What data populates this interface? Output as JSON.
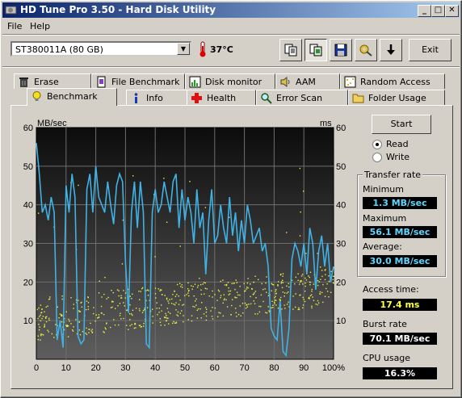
{
  "window": {
    "title": "HD Tune Pro 3.50 - Hard Disk Utility",
    "controls": {
      "minimize": "_",
      "maximize": "□",
      "close": "✕"
    }
  },
  "menu": {
    "file": "File",
    "help": "Help"
  },
  "toolbar": {
    "drive": "ST380011A (80 GB)",
    "temperature": "37°C",
    "buttons": [
      "copy-info-icon",
      "copy-screenshot-icon",
      "save-icon",
      "options-icon",
      "download-icon"
    ],
    "exit_label": "Exit"
  },
  "tabs_top": [
    {
      "label": "Erase",
      "icon": "trash-icon"
    },
    {
      "label": "File Benchmark",
      "icon": "file-benchmark-icon"
    },
    {
      "label": "Disk monitor",
      "icon": "disk-monitor-icon"
    },
    {
      "label": "AAM",
      "icon": "speaker-icon"
    },
    {
      "label": "Random Access",
      "icon": "random-access-icon"
    }
  ],
  "tabs_bottom": [
    {
      "label": "Benchmark",
      "icon": "lightbulb-icon",
      "active": true
    },
    {
      "label": "Info",
      "icon": "info-icon"
    },
    {
      "label": "Health",
      "icon": "health-cross-icon"
    },
    {
      "label": "Error Scan",
      "icon": "magnifier-icon"
    },
    {
      "label": "Folder Usage",
      "icon": "folder-icon"
    }
  ],
  "controls": {
    "start_label": "Start",
    "read_label": "Read",
    "write_label": "Write",
    "mode": "Read"
  },
  "results": {
    "group_title": "Transfer rate",
    "minimum_label": "Minimum",
    "minimum": "1.3 MB/sec",
    "maximum_label": "Maximum",
    "maximum": "56.1 MB/sec",
    "average_label": "Average:",
    "average": "30.0 MB/sec",
    "access_label": "Access time:",
    "access": "17.4 ms",
    "burst_label": "Burst rate",
    "burst": "70.1 MB/sec",
    "cpu_label": "CPU usage",
    "cpu": "16.3%"
  },
  "colors": {
    "transfer_line": "#3fb2e6",
    "access_points": "#f0f040",
    "chart_bg_top": "#111111",
    "chart_bg_bottom": "#5a5a5a",
    "value_text": "#5fd6ff"
  },
  "chart_data": {
    "type": "line",
    "ylabel_left": "MB/sec",
    "ylabel_right": "ms",
    "ylim": [
      0,
      60
    ],
    "xlim": [
      0,
      100
    ],
    "y_ticks": [
      "0",
      "10",
      "20",
      "30",
      "40",
      "50",
      "60"
    ],
    "x_ticks": [
      "0",
      "10",
      "20",
      "30",
      "40",
      "50",
      "60",
      "70",
      "80",
      "90",
      "100%"
    ],
    "grid": true,
    "series": [
      {
        "values_x": [
          0,
          1,
          2,
          3,
          4,
          5,
          6,
          7,
          8,
          9,
          10,
          11,
          12,
          13,
          14,
          15,
          16,
          17,
          18,
          19,
          20,
          21,
          22,
          23,
          24,
          25,
          26,
          27,
          28,
          29,
          30,
          31,
          32,
          33,
          34,
          35,
          36,
          37,
          38,
          39,
          40,
          41,
          42,
          43,
          44,
          45,
          46,
          47,
          48,
          49,
          50,
          51,
          52,
          53,
          54,
          55,
          56,
          57,
          58,
          59,
          60,
          61,
          62,
          63,
          64,
          65,
          66,
          67,
          68,
          69,
          70,
          71,
          72,
          73,
          74,
          75,
          76,
          77,
          78,
          79,
          80,
          81,
          82,
          83,
          84,
          85,
          86,
          87,
          88,
          89,
          90,
          91,
          92,
          93,
          94,
          95,
          96,
          97,
          98,
          99,
          100
        ],
        "values_y": [
          56,
          48,
          38,
          40,
          36,
          42,
          38,
          5,
          10,
          3,
          45,
          38,
          48,
          42,
          6,
          4,
          5,
          44,
          48,
          38,
          50,
          42,
          40,
          38,
          46,
          40,
          35,
          45,
          48,
          46,
          25,
          12,
          38,
          46,
          34,
          46,
          38,
          4,
          3,
          38,
          44,
          38,
          40,
          46,
          42,
          38,
          46,
          48,
          34,
          44,
          36,
          42,
          38,
          30,
          44,
          34,
          38,
          22,
          36,
          44,
          30,
          32,
          40,
          34,
          30,
          42,
          32,
          38,
          28,
          36,
          30,
          40,
          36,
          30,
          32,
          34,
          28,
          30,
          24,
          8,
          6,
          5,
          15,
          2,
          1,
          8,
          26,
          30,
          28,
          24,
          30,
          22,
          34,
          30,
          18,
          28,
          32,
          24,
          30,
          20,
          24
        ]
      }
    ],
    "access_points_ms": {
      "x_range": [
        0,
        100
      ],
      "y_trend_start": [
        5,
        16
      ],
      "y_trend_end": [
        14,
        24
      ]
    }
  }
}
